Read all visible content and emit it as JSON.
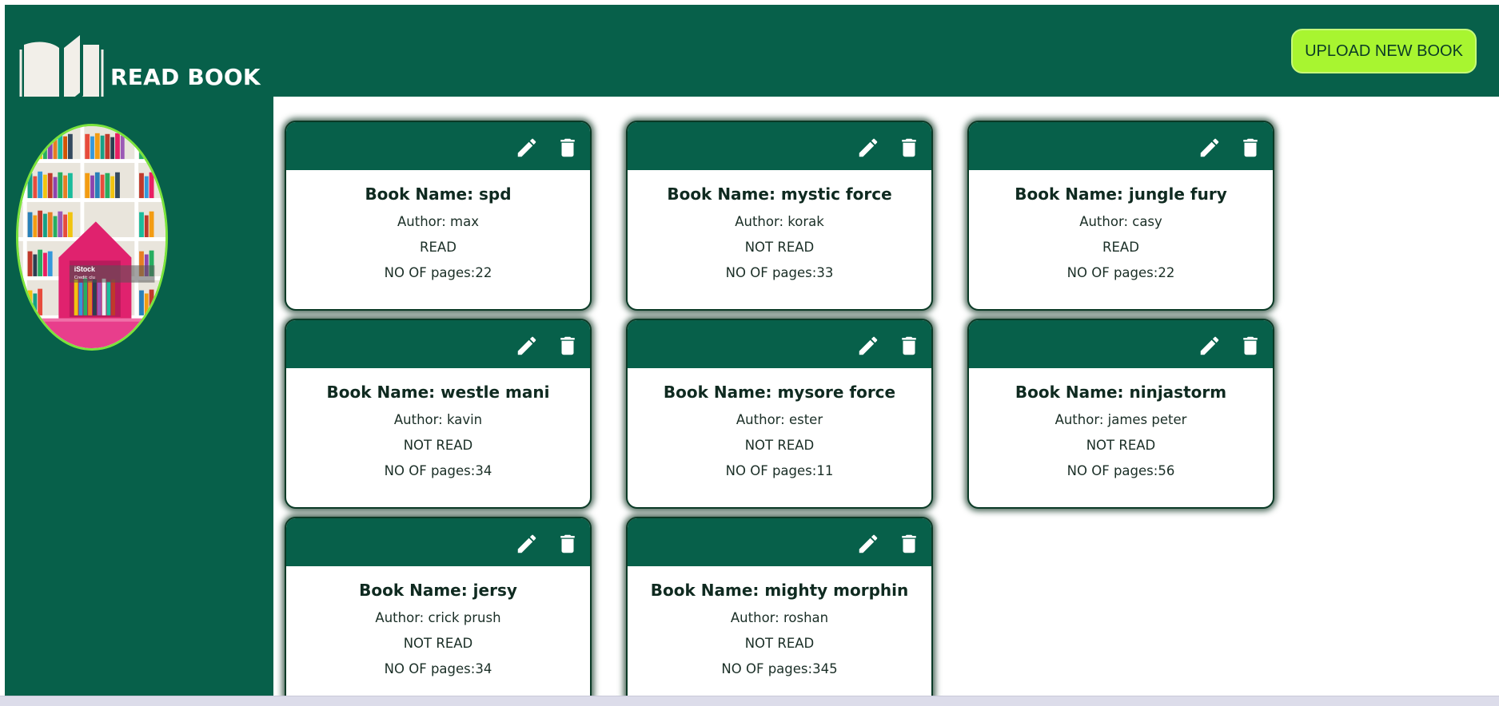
{
  "header": {
    "app_title": "READ BOOK",
    "upload_button": "UPLOAD NEW BOOK"
  },
  "colors": {
    "primary": "#07604a",
    "accent": "#a8f530",
    "avatar_border": "#7be33c"
  },
  "sidebar": {
    "avatar_caption": "iStock",
    "avatar_subcaption": "Credit: clu"
  },
  "books": [
    {
      "name_label": "Book Name: spd",
      "author_label": "Author: max",
      "status": "READ",
      "pages_label": "NO OF pages:22"
    },
    {
      "name_label": "Book Name: mystic force",
      "author_label": "Author: korak",
      "status": "NOT READ",
      "pages_label": "NO OF pages:33"
    },
    {
      "name_label": "Book Name: jungle fury",
      "author_label": "Author: casy",
      "status": "READ",
      "pages_label": "NO OF pages:22"
    },
    {
      "name_label": "Book Name: westle mani",
      "author_label": "Author: kavin",
      "status": "NOT READ",
      "pages_label": "NO OF pages:34"
    },
    {
      "name_label": "Book Name: mysore force",
      "author_label": "Author: ester",
      "status": "NOT READ",
      "pages_label": "NO OF pages:11"
    },
    {
      "name_label": "Book Name: ninjastorm",
      "author_label": "Author: james peter",
      "status": "NOT READ",
      "pages_label": "NO OF pages:56"
    },
    {
      "name_label": "Book Name: jersy",
      "author_label": "Author: crick prush",
      "status": "NOT READ",
      "pages_label": "NO OF pages:34"
    },
    {
      "name_label": "Book Name: mighty morphin",
      "author_label": "Author: roshan",
      "status": "NOT READ",
      "pages_label": "NO OF pages:345"
    }
  ],
  "icons": {
    "logo": "open-book-icon",
    "edit": "pencil-icon",
    "delete": "trash-icon"
  }
}
